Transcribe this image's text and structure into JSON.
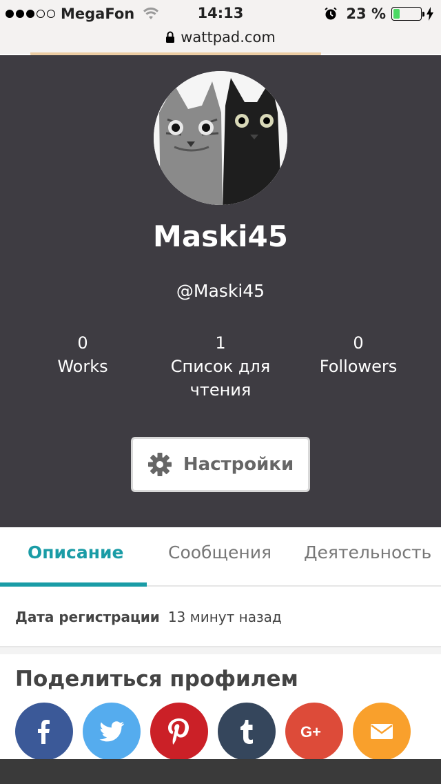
{
  "status_bar": {
    "carrier": "MegaFon",
    "time": "14:13",
    "battery_percent": "23 %",
    "battery_level": 0.23,
    "signal_dots": 5,
    "signal_filled": 3
  },
  "browser": {
    "url": "wattpad.com"
  },
  "profile": {
    "display_name": "Maski45",
    "handle": "@Maski45",
    "stats": [
      {
        "value": "0",
        "label": "Works"
      },
      {
        "value": "1",
        "label": "Список для чтения"
      },
      {
        "value": "0",
        "label": "Followers"
      }
    ],
    "settings_label": "Настройки"
  },
  "tabs": [
    {
      "label": "Описание",
      "active": true
    },
    {
      "label": "Сообщения",
      "active": false
    },
    {
      "label": "Деятельность",
      "active": false
    }
  ],
  "about": {
    "registration_label": "Дата регистрации",
    "registration_value": "13 минут назад"
  },
  "share": {
    "title": "Поделиться профилем",
    "buttons": [
      {
        "name": "facebook",
        "icon": "facebook-icon",
        "color": "#3b5998"
      },
      {
        "name": "twitter",
        "icon": "twitter-icon",
        "color": "#55acee"
      },
      {
        "name": "pinterest",
        "icon": "pinterest-icon",
        "color": "#cb2027"
      },
      {
        "name": "tumblr",
        "icon": "tumblr-icon",
        "color": "#35465c"
      },
      {
        "name": "google-plus",
        "icon": "google-plus-icon",
        "color": "#dd4b39"
      },
      {
        "name": "email",
        "icon": "email-icon",
        "color": "#f9a02c"
      }
    ]
  },
  "colors": {
    "header_bg": "#3e3c42",
    "accent": "#1a9ca6",
    "status_bar_bg": "#f4f2f1",
    "battery_fill": "#4cd964"
  }
}
